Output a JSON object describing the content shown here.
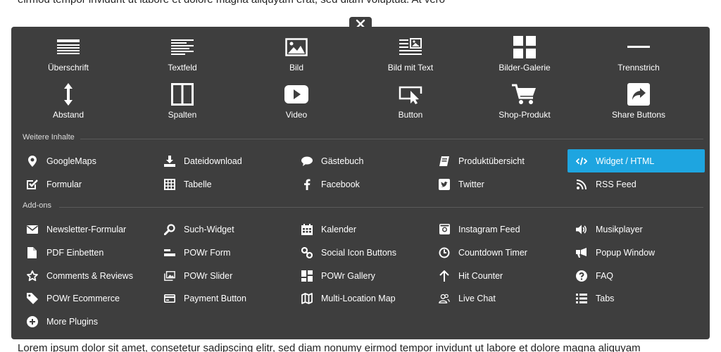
{
  "background": {
    "top_text": "eirmod tempor invidunt ut labore et dolore magna aliquyam erat, sed diam voluptua. At vero",
    "bottom_text": "Lorem ipsum dolor sit amet, consetetur sadipscing elitr, sed diam nonumy eirmod tempor invidunt ut labore et dolore magna aliquyam"
  },
  "colors": {
    "panel": "#3e3e3e",
    "accent": "#1ea5e0",
    "text": "#ffffff"
  },
  "main_items": [
    [
      {
        "label": "Überschrift",
        "icon": "heading-icon"
      },
      {
        "label": "Textfeld",
        "icon": "text-icon"
      },
      {
        "label": "Bild",
        "icon": "image-icon"
      },
      {
        "label": "Bild mit Text",
        "icon": "image-text-icon"
      },
      {
        "label": "Bilder-Galerie",
        "icon": "gallery-icon"
      },
      {
        "label": "Trennstrich",
        "icon": "divider-icon"
      }
    ],
    [
      {
        "label": "Abstand",
        "icon": "spacing-icon"
      },
      {
        "label": "Spalten",
        "icon": "columns-icon"
      },
      {
        "label": "Video",
        "icon": "video-icon"
      },
      {
        "label": "Button",
        "icon": "button-icon"
      },
      {
        "label": "Shop-Produkt",
        "icon": "cart-icon"
      },
      {
        "label": "Share Buttons",
        "icon": "share-icon"
      }
    ]
  ],
  "sections": {
    "weitere": {
      "title": "Weitere Inhalte",
      "rows": [
        [
          {
            "label": "GoogleMaps",
            "icon": "map-marker-icon"
          },
          {
            "label": "Dateidownload",
            "icon": "download-icon"
          },
          {
            "label": "Gästebuch",
            "icon": "comment-icon"
          },
          {
            "label": "Produktübersicht",
            "icon": "book-icon"
          },
          {
            "label": "Widget / HTML",
            "icon": "code-icon",
            "active": true
          }
        ],
        [
          {
            "label": "Formular",
            "icon": "checkbox-icon"
          },
          {
            "label": "Tabelle",
            "icon": "table-icon"
          },
          {
            "label": "Facebook",
            "icon": "facebook-icon"
          },
          {
            "label": "Twitter",
            "icon": "twitter-icon"
          },
          {
            "label": "RSS Feed",
            "icon": "rss-icon"
          }
        ]
      ]
    },
    "addons": {
      "title": "Add-ons",
      "rows": [
        [
          {
            "label": "Newsletter-Formular",
            "icon": "envelope-icon"
          },
          {
            "label": "Such-Widget",
            "icon": "search-icon"
          },
          {
            "label": "Kalender",
            "icon": "calendar-icon"
          },
          {
            "label": "Instagram Feed",
            "icon": "instagram-icon"
          },
          {
            "label": "Musikplayer",
            "icon": "volume-icon"
          }
        ],
        [
          {
            "label": "PDF Einbetten",
            "icon": "file-icon"
          },
          {
            "label": "POWr Form",
            "icon": "form-icon"
          },
          {
            "label": "Social Icon Buttons",
            "icon": "link-icon"
          },
          {
            "label": "Countdown Timer",
            "icon": "clock-icon"
          },
          {
            "label": "Popup Window",
            "icon": "bullhorn-icon"
          }
        ],
        [
          {
            "label": "Comments & Reviews",
            "icon": "star-icon"
          },
          {
            "label": "POWr Slider",
            "icon": "slider-images-icon"
          },
          {
            "label": "POWr Gallery",
            "icon": "grid-gallery-icon"
          },
          {
            "label": "Hit Counter",
            "icon": "arrow-up-icon"
          },
          {
            "label": "FAQ",
            "icon": "question-icon"
          }
        ],
        [
          {
            "label": "POWr Ecommerce",
            "icon": "tag-icon"
          },
          {
            "label": "Payment Button",
            "icon": "credit-card-icon"
          },
          {
            "label": "Multi-Location Map",
            "icon": "folded-map-icon"
          },
          {
            "label": "Live Chat",
            "icon": "users-icon"
          },
          {
            "label": "Tabs",
            "icon": "list-icon"
          }
        ],
        [
          {
            "label": "More Plugins",
            "icon": "plus-circle-icon"
          }
        ]
      ]
    }
  }
}
